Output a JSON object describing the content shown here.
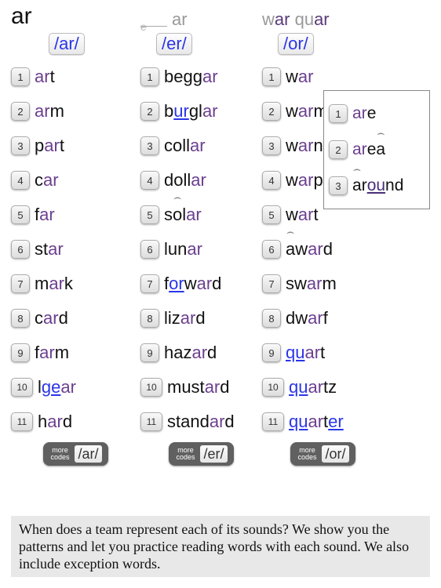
{
  "headers": {
    "col1": "ar",
    "col2_suffix": "ar",
    "col3_a": "w",
    "col3_a_ar": "ar",
    "col3_b": "qu",
    "col3_b_ar": "ar"
  },
  "sounds": {
    "c1": "/ar/",
    "c2": "/er/",
    "c3": "/or/"
  },
  "col1": [
    {
      "n": "1",
      "pre": "",
      "hl": "ar",
      "post": "t"
    },
    {
      "n": "2",
      "pre": "",
      "hl": "ar",
      "post": "m"
    },
    {
      "n": "3",
      "pre": "p",
      "hl": "ar",
      "post": "t"
    },
    {
      "n": "4",
      "pre": "c",
      "hl": "ar",
      "post": ""
    },
    {
      "n": "5",
      "pre": "f",
      "hl": "ar",
      "post": ""
    },
    {
      "n": "6",
      "pre": "st",
      "hl": "ar",
      "post": ""
    },
    {
      "n": "7",
      "pre": "m",
      "hl": "ar",
      "post": "k"
    },
    {
      "n": "8",
      "pre": "c",
      "hl": "ar",
      "post": "d"
    },
    {
      "n": "9",
      "pre": "f",
      "hl": "ar",
      "post": "m"
    },
    {
      "n": "10",
      "pre": "l",
      "hl": "ar",
      "post": "",
      "u": "ge"
    },
    {
      "n": "11",
      "pre": "h",
      "hl": "ar",
      "post": "d"
    }
  ],
  "col2": [
    {
      "n": "1",
      "pre": "begg",
      "hl": "ar",
      "post": ""
    },
    {
      "n": "2",
      "pre": "b",
      "u": "ur",
      "mid": "gl",
      "hl": "ar",
      "post": ""
    },
    {
      "n": "3",
      "pre": "coll",
      "hl": "ar",
      "post": ""
    },
    {
      "n": "4",
      "pre": "doll",
      "hl": "ar",
      "post": ""
    },
    {
      "n": "5",
      "pre": "s",
      "mac": "o",
      "mid": "l",
      "hl": "ar",
      "post": ""
    },
    {
      "n": "6",
      "pre": "lun",
      "hl": "ar",
      "post": ""
    },
    {
      "n": "7",
      "pre": "f",
      "u": "or",
      "mid": "w",
      "hl": "ar",
      "post": "d"
    },
    {
      "n": "8",
      "pre": "liz",
      "hl": "ar",
      "post": "d"
    },
    {
      "n": "9",
      "pre": "haz",
      "hl": "ar",
      "post": "d"
    },
    {
      "n": "10",
      "pre": "must",
      "hl": "ar",
      "post": "d"
    },
    {
      "n": "11",
      "pre": "stand",
      "hl": "ar",
      "post": "d"
    }
  ],
  "col3": [
    {
      "n": "1",
      "pre": "w",
      "hl": "ar",
      "post": ""
    },
    {
      "n": "2",
      "pre": "w",
      "hl": "ar",
      "post": "m"
    },
    {
      "n": "3",
      "pre": "w",
      "hl": "ar",
      "post": "n"
    },
    {
      "n": "4",
      "pre": "w",
      "hl": "ar",
      "post": "p"
    },
    {
      "n": "5",
      "pre": "w",
      "hl": "ar",
      "post": "t"
    },
    {
      "n": "6",
      "mac": "a",
      "pre": "",
      "mid": "w",
      "hl": "ar",
      "post": "d"
    },
    {
      "n": "7",
      "pre": "sw",
      "hl": "ar",
      "post": "m"
    },
    {
      "n": "8",
      "pre": "dw",
      "hl": "ar",
      "post": "f"
    },
    {
      "n": "9",
      "u": "qu",
      "hl": "ar",
      "post": "t"
    },
    {
      "n": "10",
      "u": "qu",
      "hl": "ar",
      "post": "tz"
    },
    {
      "n": "11",
      "u": "qu",
      "hl": "ar",
      "post": "t",
      "u2": "er"
    }
  ],
  "side": [
    {
      "n": "1",
      "pre": "",
      "hl": "ar",
      "post": "e"
    },
    {
      "n": "2",
      "pre": "",
      "hl": "ar",
      "post": "e",
      "mac": "a"
    },
    {
      "n": "3",
      "mac": "a",
      "pre": "",
      "mid": "r",
      "u2": "ou",
      "post": "nd"
    }
  ],
  "more": {
    "label": "more codes",
    "c1": "/ar/",
    "c2": "/er/",
    "c3": "/or/"
  },
  "footer": "When does a team represent each of its sounds? We show you the patterns and let you practice reading words with each sound. We also include exception words."
}
